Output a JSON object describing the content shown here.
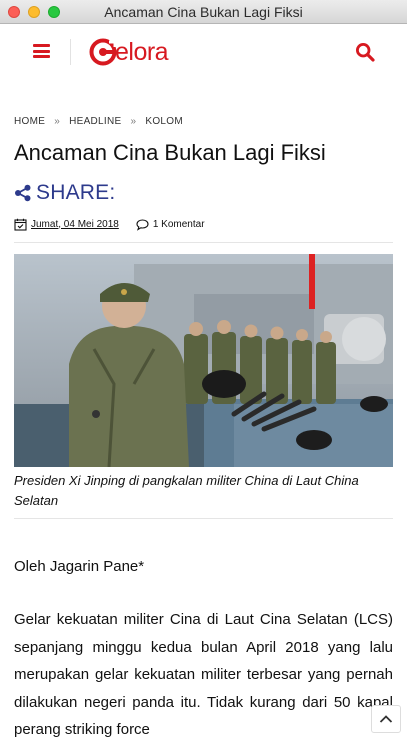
{
  "window": {
    "title": "Ancaman Cina Bukan Lagi Fiksi"
  },
  "header": {
    "logo_text": "elora",
    "logo_mark_letter": "G",
    "menu_icon": "hamburger-menu-icon",
    "search_icon": "search-icon",
    "brand_color": "#d71920"
  },
  "breadcrumb": {
    "items": [
      {
        "label": "HOME"
      },
      {
        "label": "HEADLINE"
      },
      {
        "label": "KOLOM"
      }
    ],
    "separator": "»"
  },
  "article": {
    "title": "Ancaman Cina Bukan Lagi Fiksi",
    "share_label": "SHARE:",
    "share_color": "#2d3a8c",
    "date": "Jumat, 04 Mei 2018",
    "comments": "1 Komentar",
    "image_caption": "Presiden Xi Jinping di pangkalan militer China di Laut China Selatan",
    "author": "Oleh Jagarin Pane*",
    "paragraph": "Gelar kekuatan militer Cina di Laut Cina Selatan (LCS) sepanjang minggu kedua bulan April 2018 yang lalu merupakan gelar kekuatan militer terbesar yang pernah dilakukan negeri panda itu. Tidak kurang dari 50 kapal perang striking force"
  },
  "scroll_top": {
    "icon": "chevron-up-icon"
  }
}
